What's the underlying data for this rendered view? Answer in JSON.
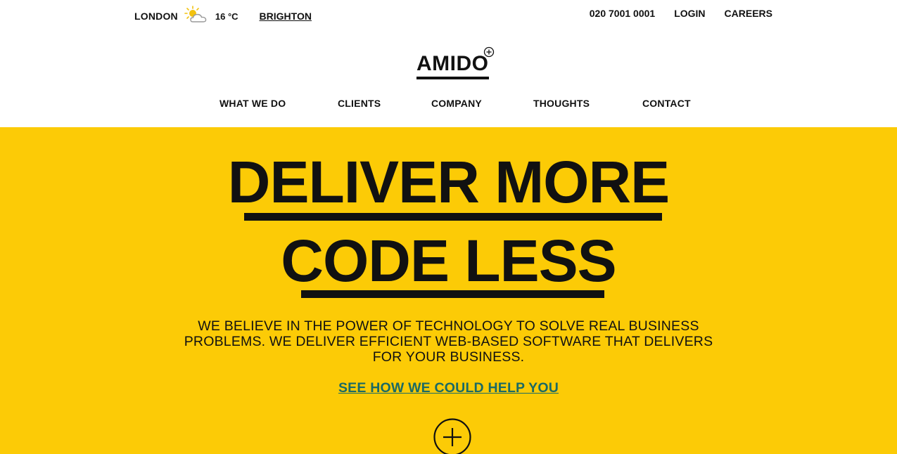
{
  "topbar": {
    "city": "LONDON",
    "weather_icon": "partly-cloudy-icon",
    "temperature": "16 °C",
    "alt_city": "BRIGHTON",
    "phone": "020 7001 0001",
    "login": "LOGIN",
    "careers": "CAREERS"
  },
  "logo": {
    "text": "AMIDO",
    "icon": "plus-circle-icon"
  },
  "nav": {
    "what_we_do": "WHAT WE DO",
    "clients": "CLIENTS",
    "company": "COMPANY",
    "thoughts": "THOUGHTS",
    "contact": "CONTACT"
  },
  "hero": {
    "headline_line1": "DELIVER MORE",
    "headline_line2": "CODE LESS",
    "intro_line1": "WE BELIEVE IN THE POWER OF TECHNOLOGY TO SOLVE REAL BUSINESS",
    "intro_line2": "PROBLEMS. WE DELIVER EFFICIENT WEB-BASED SOFTWARE THAT DELIVERS",
    "intro_line3": "FOR YOUR BUSINESS.",
    "cta": "SEE HOW WE COULD HELP YOU",
    "expand_icon": "plus-circle-icon"
  },
  "colors": {
    "hero_background": "#fccb06",
    "cta_text": "#1b6a64",
    "text": "#111111"
  }
}
